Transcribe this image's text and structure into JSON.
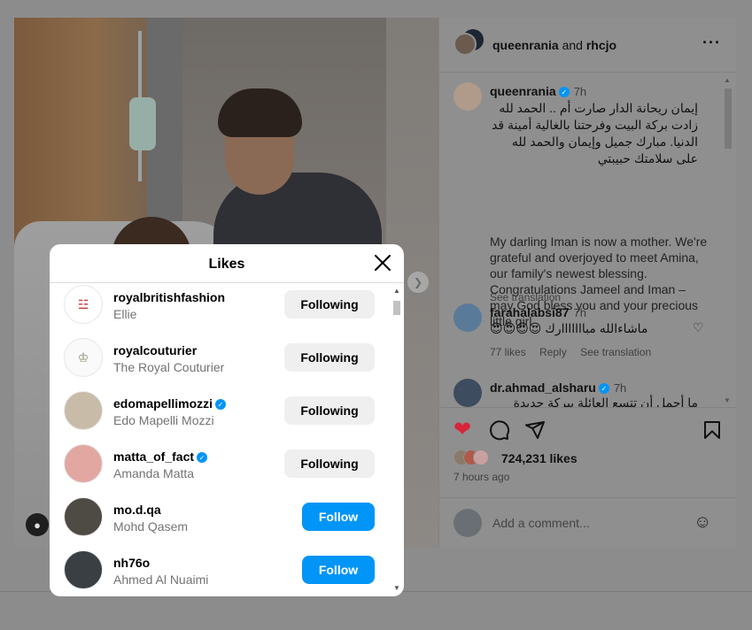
{
  "post": {
    "header": {
      "user1": "queenrania",
      "connector": "and",
      "user2": "rhcjo"
    },
    "caption": {
      "username": "queenrania",
      "time": "7h",
      "arabic": "إيمان ريحانة الدار صارت أم .. الحمد لله زادت بركة البيت وفرحتنا بالغالية أمينة قد الدنيا. مبارك جميل وإيمان والحمد لله على سلامتك حبيبتي",
      "english": "My darling Iman is now a mother. We're grateful and overjoyed to meet Amina, our family's newest blessing. Congratulations Jameel and Iman – may God bless you and your precious little girl",
      "see_translation": "See translation"
    },
    "comments": [
      {
        "username": "farahalabsi87",
        "time": "7h",
        "text": "😍😍😍😍 ماشاءالله مبااااااارك",
        "likes": "77 likes",
        "reply": "Reply",
        "see_translation": "See translation"
      },
      {
        "username": "dr.ahmad_alsharu",
        "time": "7h",
        "text": "ما أجمل أن تتسع العائلة ببركة جديدة"
      }
    ],
    "likes_count": "724,231 likes",
    "time_ago": "7 hours ago",
    "add_comment_placeholder": "Add a comment..."
  },
  "likes_modal": {
    "title": "Likes",
    "users": [
      {
        "username": "royalbritishfashion",
        "name": "Ellie",
        "verified": false,
        "button": "Following"
      },
      {
        "username": "royalcouturier",
        "name": "The Royal Couturier",
        "verified": false,
        "button": "Following"
      },
      {
        "username": "edomapellimozzi",
        "name": "Edo Mapelli Mozzi",
        "verified": true,
        "button": "Following"
      },
      {
        "username": "matta_of_fact",
        "name": "Amanda Matta",
        "verified": true,
        "button": "Following"
      },
      {
        "username": "mo.d.qa",
        "name": "Mohd Qasem",
        "verified": false,
        "button": "Follow"
      },
      {
        "username": "nh76o",
        "name": "Ahmed Al Nuaimi",
        "verified": false,
        "button": "Follow"
      }
    ]
  },
  "icons": {
    "more": "more-horizontal-icon",
    "like": "heart-filled-icon",
    "comment": "comment-icon",
    "share": "paper-plane-icon",
    "save": "bookmark-icon",
    "emoji": "emoji-icon",
    "close": "close-icon",
    "user_tag": "user-icon",
    "next": "chevron-right-icon"
  },
  "colors": {
    "like": "#d8253a",
    "follow_button": "#0095f6",
    "following_button": "#efefef",
    "verified": "#0095f6"
  }
}
